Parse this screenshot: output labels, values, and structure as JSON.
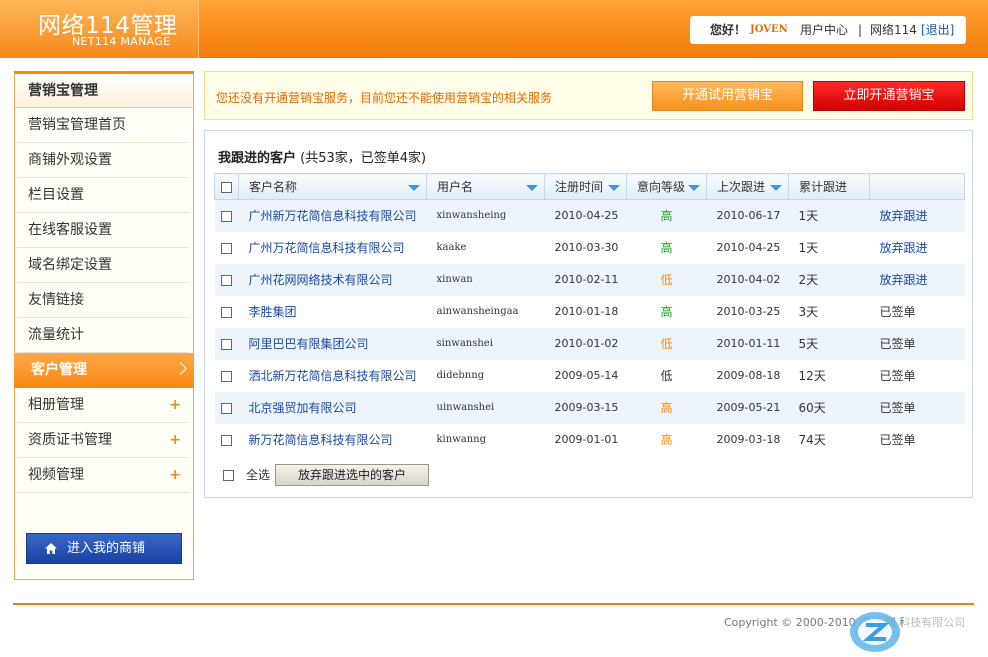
{
  "header": {
    "logo_main": "网络114管理",
    "logo_sub": "NET114 MANAGE",
    "greeting": "您好！",
    "username": "JOVEN",
    "user_center": "用户中心",
    "separator": "|",
    "site_link": "网络114",
    "logout": "[退出]"
  },
  "sidebar": {
    "title": "营销宝管理",
    "items": [
      {
        "label": "营销宝管理首页"
      },
      {
        "label": "商铺外观设置"
      },
      {
        "label": "栏目设置"
      },
      {
        "label": "在线客服设置"
      },
      {
        "label": "域名绑定设置"
      },
      {
        "label": "友情链接"
      },
      {
        "label": "流量统计"
      },
      {
        "label": "客户管理",
        "active": true
      },
      {
        "label": "相册管理",
        "expand": "+"
      },
      {
        "label": "资质证书管理",
        "expand": "+"
      },
      {
        "label": "视频管理",
        "expand": "+"
      }
    ],
    "shop_button": "进入我的商铺"
  },
  "notice": {
    "text": "您还没有开通营销宝服务，目前您还不能使用营销宝的相关服务",
    "trial_button": "开通试用营销宝",
    "open_button": "立即开通营销宝"
  },
  "panel": {
    "title": "我跟进的客户",
    "summary": "(共53家，已签单4家)",
    "columns": [
      "客户名称",
      "用户名",
      "注册时间",
      "意向等级",
      "上次跟进",
      "累计跟进",
      ""
    ],
    "rows": [
      {
        "customer": "广州新万花简信息科技有限公司",
        "username": "xinwansheing",
        "reg_date": "2010-04-25",
        "level": "高",
        "level_type": "hi",
        "last_follow": "2010-06-17",
        "total": "1天",
        "action": "放弃跟进",
        "action_link": true
      },
      {
        "customer": "广州万花简信息科技有限公司",
        "username": "kaake",
        "reg_date": "2010-03-30",
        "level": "高",
        "level_type": "hi",
        "last_follow": "2010-04-25",
        "total": "1天",
        "action": "放弃跟进",
        "action_link": true
      },
      {
        "customer": "广州花网网络技术有限公司",
        "username": "xinwan",
        "reg_date": "2010-02-11",
        "level": "低",
        "level_type": "lo",
        "last_follow": "2010-04-02",
        "total": "2天",
        "action": "放弃跟进",
        "action_link": true
      },
      {
        "customer": "李胜集团",
        "username": "ainwansheingaa",
        "reg_date": "2010-01-18",
        "level": "高",
        "level_type": "hi",
        "last_follow": "2010-03-25",
        "total": "3天",
        "action": "已签单",
        "action_link": false
      },
      {
        "customer": "阿里巴巴有限集团公司",
        "username": "sinwanshei",
        "reg_date": "2010-01-02",
        "level": "低",
        "level_type": "lo",
        "last_follow": "2010-01-11",
        "total": "5天",
        "action": "已签单",
        "action_link": false
      },
      {
        "customer": "洒北新万花简信息科技有限公司",
        "username": "didebnng",
        "reg_date": "2009-05-14",
        "level": "低",
        "level_type": "mid",
        "last_follow": "2009-08-18",
        "total": "12天",
        "action": "已签单",
        "action_link": false
      },
      {
        "customer": "北京强贸加有限公司",
        "username": "uinwanshei",
        "reg_date": "2009-03-15",
        "level": "高",
        "level_type": "lo",
        "last_follow": "2009-05-21",
        "total": "60天",
        "action": "已签单",
        "action_link": false
      },
      {
        "customer": "新万花简信息科技有限公司",
        "username": "kinwanng",
        "reg_date": "2009-01-01",
        "level": "高",
        "level_type": "lo",
        "last_follow": "2009-03-18",
        "total": "74天",
        "action": "已签单",
        "action_link": false
      }
    ],
    "select_all": "全选",
    "abandon_selected": "放弃跟进选中的客户"
  },
  "footer": {
    "copyright": "Copyright © 2000-2010 广州 网 科技有限公司"
  },
  "colors": {
    "brand_orange": "#f47a07",
    "link_blue": "#1a47a8",
    "level_high": "#1f9c1f",
    "level_low": "#ff8800",
    "open_red": "#d40000"
  }
}
